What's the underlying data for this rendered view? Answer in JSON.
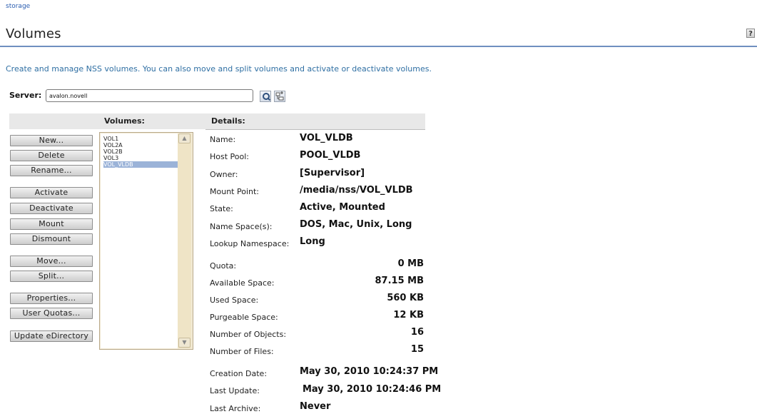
{
  "breadcrumb": "storage",
  "page_title": "Volumes",
  "help_label": "?",
  "description": "Create and manage NSS volumes. You can also move and split volumes and activate or deactivate volumes.",
  "server": {
    "label": "Server:",
    "value": "avalon.novell"
  },
  "columns": {
    "volumes": "Volumes:",
    "details": "Details:"
  },
  "actions": {
    "new": "New...",
    "delete": "Delete",
    "rename": "Rename...",
    "activate": "Activate",
    "deactivate": "Deactivate",
    "mount": "Mount",
    "dismount": "Dismount",
    "move": "Move...",
    "split": "Split...",
    "properties": "Properties...",
    "user_quotas": "User Quotas...",
    "update_edirectory": "Update eDirectory"
  },
  "volumes": [
    "VOL1",
    "VOL2A",
    "VOL2B",
    "VOL3",
    "VOL_VLDB"
  ],
  "selected_volume": "VOL_VLDB",
  "details": {
    "name": {
      "label": "Name:",
      "value": "VOL_VLDB"
    },
    "host_pool": {
      "label": "Host Pool:",
      "value": "POOL_VLDB"
    },
    "owner": {
      "label": "Owner:",
      "value": "[Supervisor]"
    },
    "mount_point": {
      "label": "Mount Point:",
      "value": "/media/nss/VOL_VLDB"
    },
    "state": {
      "label": "State:",
      "value": "Active, Mounted"
    },
    "name_spaces": {
      "label": "Name Space(s):",
      "value": "DOS, Mac, Unix, Long"
    },
    "lookup_namespace": {
      "label": "Lookup Namespace:",
      "value": "Long"
    },
    "quota": {
      "label": "Quota:",
      "value": "0 MB"
    },
    "available_space": {
      "label": "Available Space:",
      "value": "87.15 MB"
    },
    "used_space": {
      "label": "Used Space:",
      "value": "560 KB"
    },
    "purgeable_space": {
      "label": "Purgeable Space:",
      "value": "12 KB"
    },
    "number_of_objects": {
      "label": "Number of Objects:",
      "value": "16"
    },
    "number_of_files": {
      "label": "Number of Files:",
      "value": "15"
    },
    "creation_date": {
      "label": "Creation Date:",
      "value": "May 30, 2010 10:24:37 PM"
    },
    "last_update": {
      "label": "Last Update:",
      "value": "May 30, 2010 10:24:46 PM"
    },
    "last_archive": {
      "label": "Last Archive:",
      "value": "Never"
    }
  },
  "colors": {
    "accent": "#2f6fa3",
    "title_rule": "#6f8fc0",
    "selection": "#9bb3d8",
    "list_frame": "#f2ead5"
  },
  "icons": [
    "search-icon",
    "browse-tree-icon",
    "scroll-up-icon",
    "scroll-down-icon"
  ]
}
